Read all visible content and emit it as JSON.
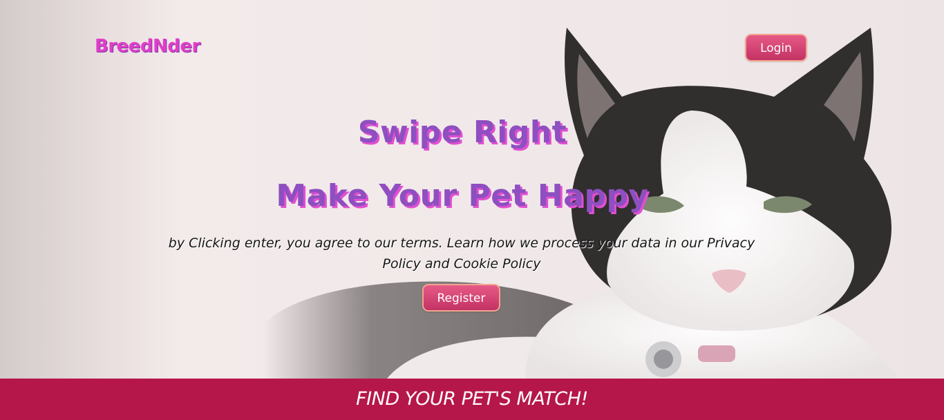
{
  "header": {
    "brand": "BreedNder",
    "login_label": "Login"
  },
  "hero": {
    "headline_1": "Swipe Right",
    "headline_2": "Make Your Pet Happy",
    "terms_text": "by Clicking enter, you agree to our terms. Learn how we process your data in our Privacy Policy and Cookie Policy",
    "register_label": "Register",
    "background_image": "black-and-white-cat-photo"
  },
  "banner": {
    "text": "FIND YOUR PET'S MATCH!"
  },
  "colors": {
    "brand": "#e03ec8",
    "headline": "#8e4fc0",
    "headline_shadow": "#e14fd1",
    "button_top": "#e65a86",
    "button_bottom": "#c33264",
    "button_border": "#f3a58f",
    "banner": "#b5174a"
  }
}
